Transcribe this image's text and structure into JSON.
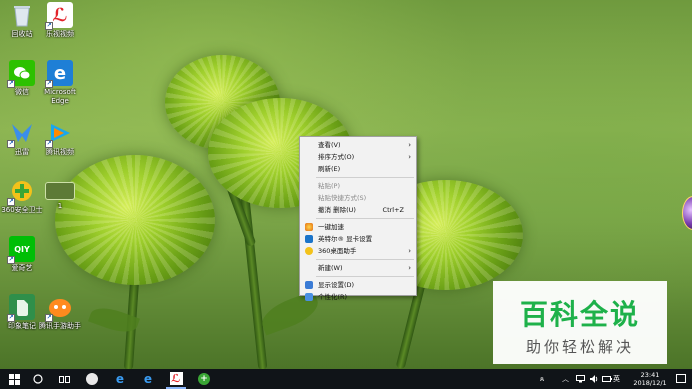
{
  "desktop_icons": [
    {
      "label": "回收站",
      "icon": "recycle-bin-icon"
    },
    {
      "label": "乐视视频",
      "icon": "letv-icon"
    },
    {
      "label": "微信",
      "icon": "wechat-icon"
    },
    {
      "label": "Microsoft Edge",
      "icon": "edge-icon"
    },
    {
      "label": "迅雷",
      "icon": "xunlei-icon"
    },
    {
      "label": "腾讯视频",
      "icon": "tencent-video-icon"
    },
    {
      "label": "360安全卫士",
      "icon": "360-safe-icon"
    },
    {
      "label": "1",
      "icon": "folder-thumbnail-icon"
    },
    {
      "label": "爱奇艺",
      "icon": "iqiyi-icon"
    },
    {
      "label": "印象笔记",
      "icon": "evernote-icon"
    },
    {
      "label": "腾讯手游助手",
      "icon": "tencent-game-assistant-icon"
    }
  ],
  "context_menu": {
    "items": [
      {
        "label": "查看(V)",
        "submenu": true
      },
      {
        "label": "排序方式(O)",
        "submenu": true
      },
      {
        "label": "刷新(E)"
      },
      {
        "label": "粘贴(P)",
        "disabled": true
      },
      {
        "label": "粘贴快捷方式(S)",
        "disabled": true
      },
      {
        "label": "撤消 删除(U)",
        "shortcut": "Ctrl+Z"
      },
      {
        "label": "一键加速",
        "icon": "boost-icon"
      },
      {
        "label": "英特尔® 显卡设置",
        "icon": "intel-graphics-icon"
      },
      {
        "label": "360桌面助手",
        "icon": "360-desktop-icon",
        "submenu": true
      },
      {
        "label": "新建(W)",
        "submenu": true
      },
      {
        "label": "显示设置(D)",
        "icon": "display-settings-icon"
      },
      {
        "label": "个性化(R)",
        "icon": "personalize-icon"
      }
    ]
  },
  "watermark": {
    "title": "百科全说",
    "subtitle": "助你轻松解决"
  },
  "taskbar": {
    "apps": [
      "windows-start-icon",
      "search-circle-icon",
      "task-view-icon",
      "fan-app-icon",
      "edge-icon",
      "edge-icon",
      "letv-icon",
      "360-icon"
    ],
    "tray": {
      "ime": "英",
      "time": "23:41",
      "date": "2018/12/1"
    }
  },
  "colors": {
    "watermark_green": "#1eb14a",
    "taskbar": "#101418",
    "menu_bg": "#f2f2f2"
  }
}
